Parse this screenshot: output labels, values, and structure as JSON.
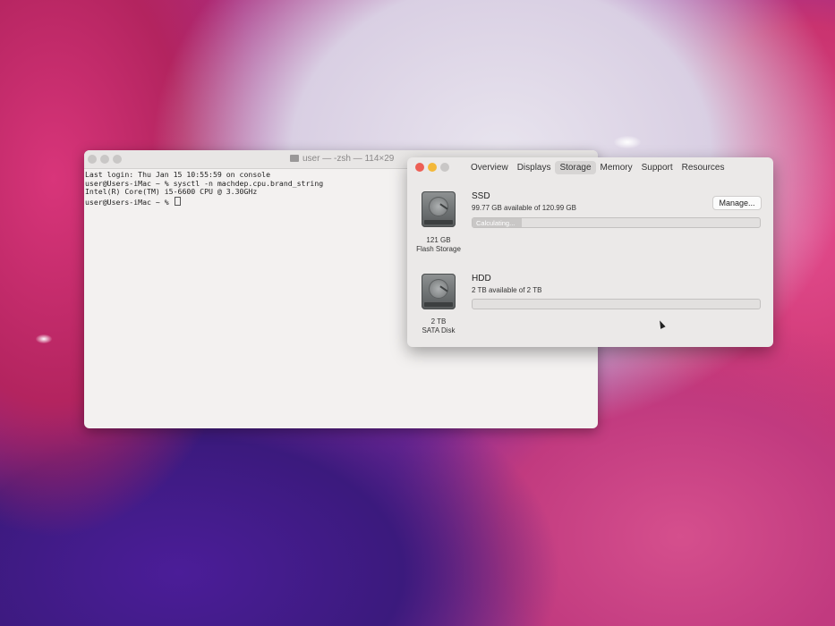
{
  "terminal": {
    "title": "user — -zsh — 114×29",
    "lines": [
      "Last login: Thu Jan 15 10:55:59 on console",
      "user@Users-iMac ~ % sysctl -n machdep.cpu.brand_string",
      "Intel(R) Core(TM) i5-6600 CPU @ 3.30GHz",
      "user@Users-iMac ~ % "
    ]
  },
  "about": {
    "tabs": [
      "Overview",
      "Displays",
      "Storage",
      "Memory",
      "Support",
      "Resources"
    ],
    "active_tab": "Storage",
    "manage_label": "Manage...",
    "disks": [
      {
        "name": "SSD",
        "available": "99.77 GB available of 120.99 GB",
        "bar_text": "Calculating...",
        "bar_fill_fraction": 0.17,
        "size": "121 GB",
        "kind": "Flash Storage"
      },
      {
        "name": "HDD",
        "available": "2 TB available of 2 TB",
        "bar_fill_fraction": 0.0,
        "size": "2 TB",
        "kind": "SATA Disk"
      }
    ]
  },
  "colors": {
    "close": "#ed5f55",
    "minimize": "#f3b83a",
    "zoom_inactive": "#c9c7c6"
  }
}
